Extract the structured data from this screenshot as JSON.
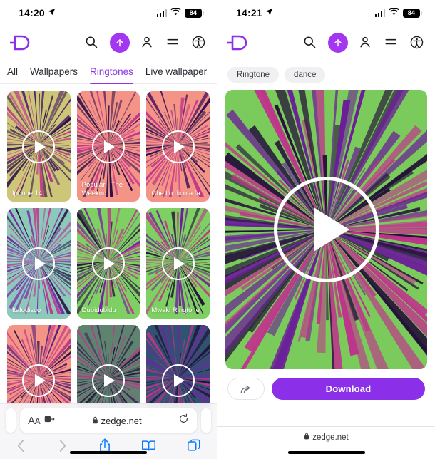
{
  "colors": {
    "brand_purple": "#8b30e8",
    "accent_purple": "#a435f0",
    "tab_active": "#8b3ae0",
    "safari_blue": "#0a7bff",
    "hero_green": "#7bcb5c"
  },
  "left": {
    "status": {
      "time": "14:20",
      "location_icon": "location-arrow-icon",
      "battery": "84"
    },
    "header": {
      "logo": "zedge-logo",
      "icons": [
        {
          "name": "search-icon",
          "label": "Search"
        },
        {
          "name": "upload-icon",
          "label": "Upload"
        },
        {
          "name": "account-icon",
          "label": "Account"
        },
        {
          "name": "menu-icon",
          "label": "Menu"
        },
        {
          "name": "accessibility-icon",
          "label": "Accessibility"
        }
      ]
    },
    "tabs": [
      {
        "label": "All",
        "active": false
      },
      {
        "label": "Wallpapers",
        "active": false
      },
      {
        "label": "Ringtones",
        "active": true
      },
      {
        "label": "Live wallpaper",
        "active": false
      }
    ],
    "cards": [
      {
        "title": "Iphone 14",
        "bg": "#cdc577",
        "burst": "#2b1048",
        "accent": "#4a1a6b"
      },
      {
        "title": "Popular - The Weeknd",
        "bg": "#f49486",
        "burst": "#2b1048",
        "accent": "#55205f"
      },
      {
        "title": "Che t'o dico a fa",
        "bg": "#f49486",
        "burst": "#2e1150",
        "accent": "#46155e"
      },
      {
        "title": "Italodisco",
        "bg": "#8cc9bb",
        "burst": "#7a1fa8",
        "accent": "#2a1242"
      },
      {
        "title": "Dubidubidu",
        "bg": "#7fd063",
        "burst": "#7a1fa8",
        "accent": "#2a1242"
      },
      {
        "title": "Mwaki Ringtone",
        "bg": "#7fd063",
        "burst": "#6b1d99",
        "accent": "#241039"
      },
      {
        "title": "",
        "bg": "#f49486",
        "burst": "#55207f",
        "accent": "#2b1048"
      },
      {
        "title": "",
        "bg": "#5e8470",
        "burst": "#3d2053",
        "accent": "#241039"
      },
      {
        "title": "",
        "bg": "#2f5370",
        "burst": "#6b2a9c",
        "accent": "#241039"
      }
    ],
    "safari": {
      "reader_label": "AA",
      "reader_icon": "text-size-icon",
      "extensions_icon": "extensions-icon",
      "lock_icon": "lock-icon",
      "url": "zedge.net",
      "reload_icon": "reload-icon",
      "toolbar": [
        {
          "name": "back-button",
          "icon": "chevron-left-icon",
          "enabled": false
        },
        {
          "name": "forward-button",
          "icon": "chevron-right-icon",
          "enabled": false
        },
        {
          "name": "share-button",
          "icon": "share-icon",
          "enabled": true
        },
        {
          "name": "bookmarks-button",
          "icon": "book-icon",
          "enabled": true
        },
        {
          "name": "tabs-button",
          "icon": "tabs-icon",
          "enabled": true
        }
      ]
    }
  },
  "right": {
    "status": {
      "time": "14:21",
      "location_icon": "location-arrow-icon",
      "battery": "84"
    },
    "header": {
      "logo": "zedge-logo",
      "icons": [
        {
          "name": "search-icon",
          "label": "Search"
        },
        {
          "name": "upload-icon",
          "label": "Upload"
        },
        {
          "name": "account-icon",
          "label": "Account"
        },
        {
          "name": "menu-icon",
          "label": "Menu"
        },
        {
          "name": "accessibility-icon",
          "label": "Accessibility"
        }
      ]
    },
    "chips": [
      {
        "label": "Ringtone"
      },
      {
        "label": "dance"
      }
    ],
    "hero": {
      "bg": "#7bcb5c",
      "burst": "#6b1d99",
      "accent": "#241039",
      "play_icon": "play-icon"
    },
    "actions": {
      "share_icon": "share-arrow-icon",
      "download_label": "Download"
    },
    "bottom": {
      "lock_icon": "lock-icon",
      "url": "zedge.net"
    }
  }
}
